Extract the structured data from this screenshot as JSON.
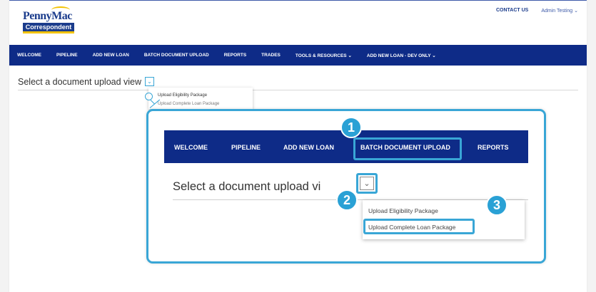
{
  "brand": {
    "logo_top": "PennyMac",
    "logo_bottom": "Correspondent"
  },
  "top_links": {
    "contact": "CONTACT US",
    "user": "Admin Testing ⌄"
  },
  "nav": {
    "items": [
      "WELCOME",
      "PIPELINE",
      "ADD NEW LOAN",
      "BATCH DOCUMENT UPLOAD",
      "REPORTS",
      "TRADES",
      "TOOLS & RESOURCES ⌄",
      "ADD NEW LOAN - DEV ONLY ⌄"
    ]
  },
  "section": {
    "title": "Select a document upload view",
    "chevron": "⌄"
  },
  "mini_menu": {
    "item1": "Upload Eligibility Package",
    "item2": "Upload Complete Loan Package"
  },
  "zoom": {
    "nav_items": [
      "WELCOME",
      "PIPELINE",
      "ADD NEW LOAN",
      "BATCH DOCUMENT UPLOAD",
      "REPORTS"
    ],
    "title": "Select a document upload vi",
    "chevron": "⌄",
    "menu_items": [
      "Upload Eligibility Package",
      "Upload Complete Loan Package"
    ]
  },
  "badges": [
    "1",
    "2",
    "3"
  ],
  "colors": {
    "nav_bg": "#0e2b87",
    "highlight": "#39a6d6",
    "badge": "#2aa1d5",
    "brand_yellow": "#f2c200"
  },
  "icons": [
    "magnifier-icon",
    "chevron-down-icon"
  ]
}
